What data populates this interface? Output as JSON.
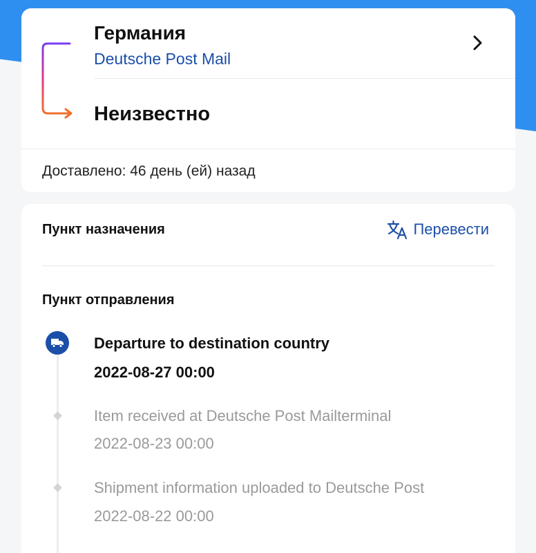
{
  "route": {
    "origin_country": "Германия",
    "carrier": "Deutsche Post Mail",
    "destination_country": "Неизвестно",
    "delivered_status": "Доставлено: 46 день (ей) назад"
  },
  "details": {
    "destination_section": "Пункт назначения",
    "translate_label": "Перевести",
    "origin_section": "Пункт отправления",
    "events": [
      {
        "title": "Departure to destination country",
        "time": "2022-08-27 00:00"
      },
      {
        "title": "Item received at Deutsche Post Mailterminal",
        "time": "2022-08-23 00:00"
      },
      {
        "title": "Shipment information uploaded to Deutsche Post",
        "time": "2022-08-22 00:00"
      }
    ]
  },
  "icons": {
    "route": "route-bracket-icon",
    "chevron": "chevron-right-icon",
    "translate": "translate-icon",
    "current_event": "truck-icon"
  },
  "colors": {
    "accent": "#1b4fa8",
    "header_bg": "#2f8ff0",
    "route_gradient_start": "#7b3cf0",
    "route_gradient_mid": "#e0388a",
    "route_gradient_end": "#f0702a"
  }
}
